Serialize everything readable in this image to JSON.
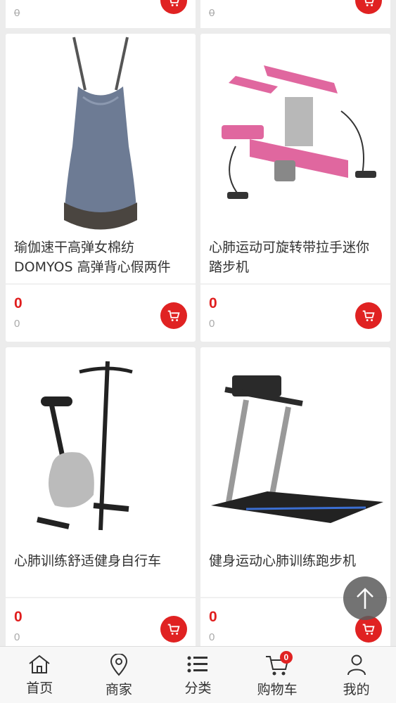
{
  "top_partial": [
    {
      "old_price": "0"
    },
    {
      "old_price": "0"
    }
  ],
  "products": [
    {
      "title": "瑜伽速干高弹女棉纺DOMYOS 高弹背心假两件",
      "price": "0",
      "old_price": "0",
      "image": "tank-top-dress"
    },
    {
      "title": "心肺运动可旋转带拉手迷你踏步机",
      "price": "0",
      "old_price": "0",
      "image": "mini-stepper"
    },
    {
      "title": "心肺训练舒适健身自行车",
      "price": "0",
      "old_price": "0",
      "image": "exercise-bike"
    },
    {
      "title": "健身运动心肺训练跑步机",
      "price": "0",
      "old_price": "0",
      "image": "treadmill"
    }
  ],
  "tabbar": {
    "items": [
      {
        "label": "首页",
        "icon": "home-icon"
      },
      {
        "label": "商家",
        "icon": "location-pin-icon"
      },
      {
        "label": "分类",
        "icon": "list-icon"
      },
      {
        "label": "购物车",
        "icon": "cart-icon",
        "badge": "0"
      },
      {
        "label": "我的",
        "icon": "user-icon"
      }
    ]
  },
  "colors": {
    "accent": "#e02222",
    "price": "#e01e1e"
  }
}
